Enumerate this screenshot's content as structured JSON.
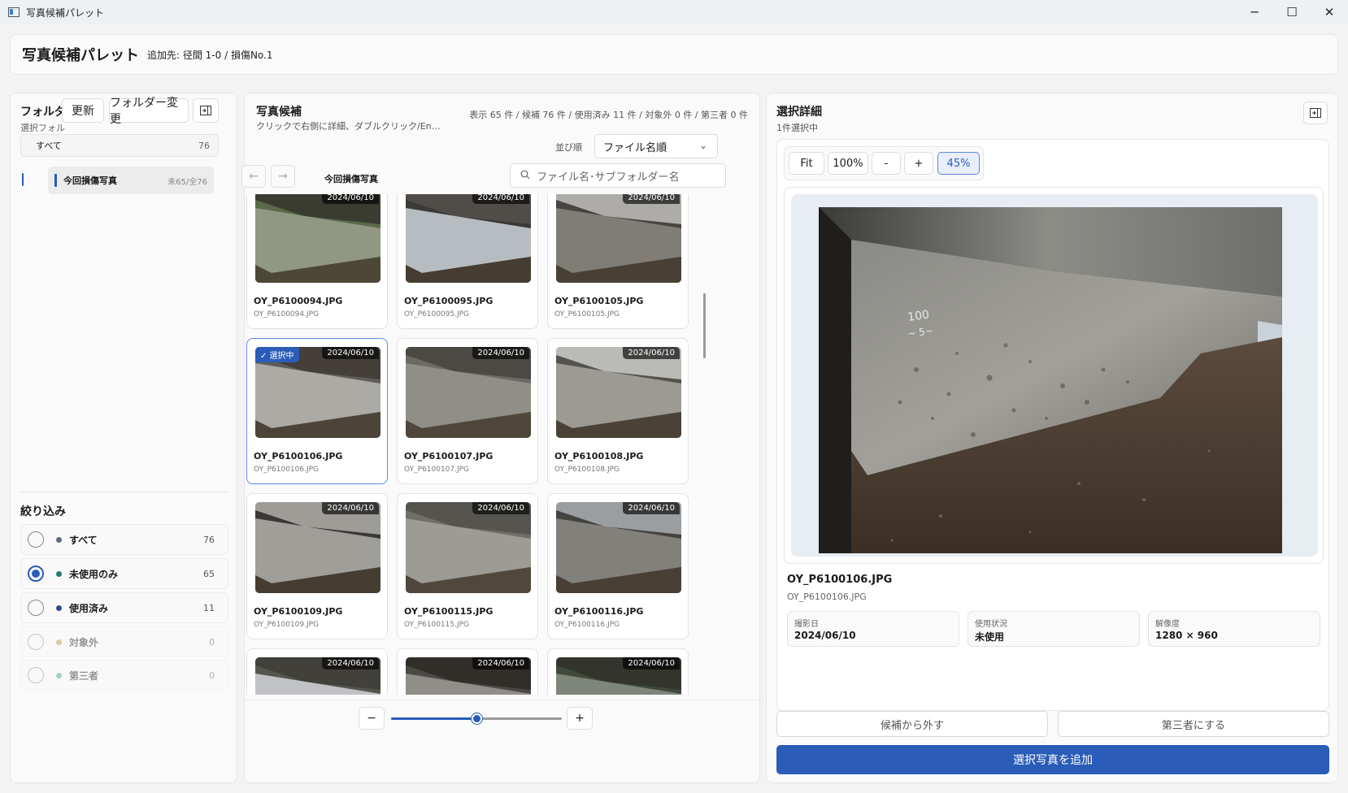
{
  "window": {
    "title": "写真候補パレット",
    "controls": [
      "─",
      "☐",
      "✕"
    ]
  },
  "header": {
    "title": "写真候補パレット",
    "target": "追加先: 径間 1-0 / 損傷No.1"
  },
  "folder_panel": {
    "title": "フォルダ",
    "subtitle": "選択フォル",
    "refresh_label": "更新",
    "change_label": "フォルダー変更",
    "all_label": "すべて",
    "all_count": "76",
    "folder_name": "今回損傷写真",
    "folder_count": "未65/全76"
  },
  "filter_panel": {
    "title": "絞り込み",
    "items": [
      {
        "label": "すべて",
        "count": "76",
        "color": "#5a6a80",
        "checked": false,
        "enabled": true
      },
      {
        "label": "未使用のみ",
        "count": "65",
        "color": "#1e7a6e",
        "checked": true,
        "enabled": true
      },
      {
        "label": "使用済み",
        "count": "11",
        "color": "#2a4f8a",
        "checked": false,
        "enabled": true
      },
      {
        "label": "対象外",
        "count": "0",
        "color": "#c28a3a",
        "checked": false,
        "enabled": false
      },
      {
        "label": "第三者",
        "count": "0",
        "color": "#3aa878",
        "checked": false,
        "enabled": false
      }
    ]
  },
  "candidates": {
    "title": "写真候補",
    "subtitle": "クリックで右側に詳細、ダブルクリック/Enterで追...",
    "stats": "表示 65 件 / 候補 76 件 / 使用済み 11 件 / 対象外 0 件 / 第三者 0 件",
    "sort_label": "並び順",
    "sort_value": "ファイル名順",
    "breadcrumb": "今回損傷写真",
    "search_placeholder": "ファイル名･サブフォルダー名",
    "selected_badge": "✓ 選択中",
    "photos": [
      {
        "name": "OY_P6100094.JPG",
        "sub": "OY_P6100094.JPG",
        "date": "2024/06/10",
        "selected": false
      },
      {
        "name": "OY_P6100095.JPG",
        "sub": "OY_P6100095.JPG",
        "date": "2024/06/10",
        "selected": false
      },
      {
        "name": "OY_P6100105.JPG",
        "sub": "OY_P6100105.JPG",
        "date": "2024/06/10",
        "selected": false
      },
      {
        "name": "OY_P6100106.JPG",
        "sub": "OY_P6100106.JPG",
        "date": "2024/06/10",
        "selected": true
      },
      {
        "name": "OY_P6100107.JPG",
        "sub": "OY_P6100107.JPG",
        "date": "2024/06/10",
        "selected": false
      },
      {
        "name": "OY_P6100108.JPG",
        "sub": "OY_P6100108.JPG",
        "date": "2024/06/10",
        "selected": false
      },
      {
        "name": "OY_P6100109.JPG",
        "sub": "OY_P6100109.JPG",
        "date": "2024/06/10",
        "selected": false
      },
      {
        "name": "OY_P6100115.JPG",
        "sub": "OY_P6100115.JPG",
        "date": "2024/06/10",
        "selected": false
      },
      {
        "name": "OY_P6100116.JPG",
        "sub": "OY_P6100116.JPG",
        "date": "2024/06/10",
        "selected": false
      },
      {
        "name": "",
        "sub": "",
        "date": "2024/06/10",
        "selected": false
      },
      {
        "name": "",
        "sub": "",
        "date": "2024/06/10",
        "selected": false
      },
      {
        "name": "",
        "sub": "",
        "date": "2024/06/10",
        "selected": false
      }
    ],
    "zoom_minus": "−",
    "zoom_plus": "+",
    "zoom_level": 0.5
  },
  "detail": {
    "title": "選択詳細",
    "subtitle": "1件選択中",
    "zoom_buttons": [
      "Fit",
      "100%",
      "-",
      "+",
      "45%"
    ],
    "file_name": "OY_P6100106.JPG",
    "file_sub": "OY_P6100106.JPG",
    "meta": [
      {
        "label": "撮影日",
        "value": "2024/06/10"
      },
      {
        "label": "使用状況",
        "value": "未使用"
      },
      {
        "label": "解像度",
        "value": "1280 × 960"
      }
    ],
    "remove_label": "候補から外す",
    "third_party_label": "第三者にする",
    "add_label": "選択写真を追加"
  }
}
